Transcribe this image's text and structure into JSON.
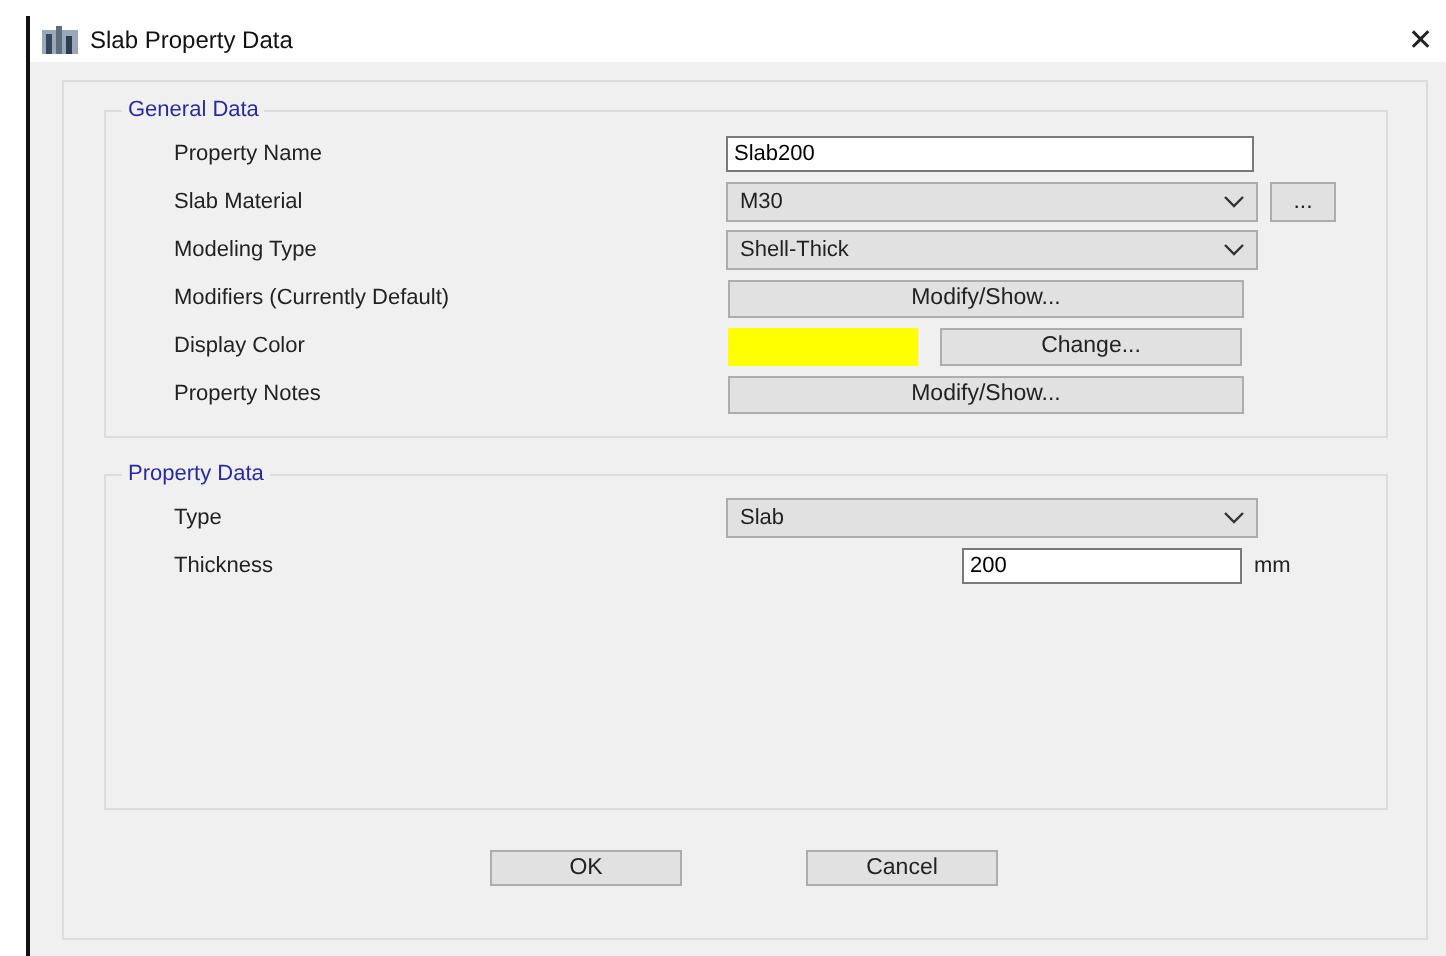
{
  "window": {
    "title": "Slab Property Data",
    "close": "✕"
  },
  "groups": [
    {
      "title": "General Data",
      "rows": [
        {
          "label": "Property Name",
          "kind": "text",
          "value": "Slab200"
        },
        {
          "label": "Slab Material",
          "kind": "combo",
          "value": "M30",
          "button": "..."
        },
        {
          "label": "Modeling Type",
          "kind": "combo",
          "value": "Shell-Thick"
        },
        {
          "label": "Modifiers (Currently Default)",
          "kind": "button",
          "button": "Modify/Show..."
        },
        {
          "label": "Display Color",
          "kind": "color",
          "color": "#ffff00",
          "button": "Change..."
        },
        {
          "label": "Property Notes",
          "kind": "button",
          "button": "Modify/Show..."
        }
      ]
    },
    {
      "title": "Property Data",
      "rows": [
        {
          "label": "Type",
          "kind": "combo",
          "value": "Slab"
        },
        {
          "label": "Thickness",
          "kind": "unit",
          "value": "200",
          "unit": "mm"
        }
      ]
    }
  ],
  "buttons": [
    "OK",
    "Cancel"
  ]
}
